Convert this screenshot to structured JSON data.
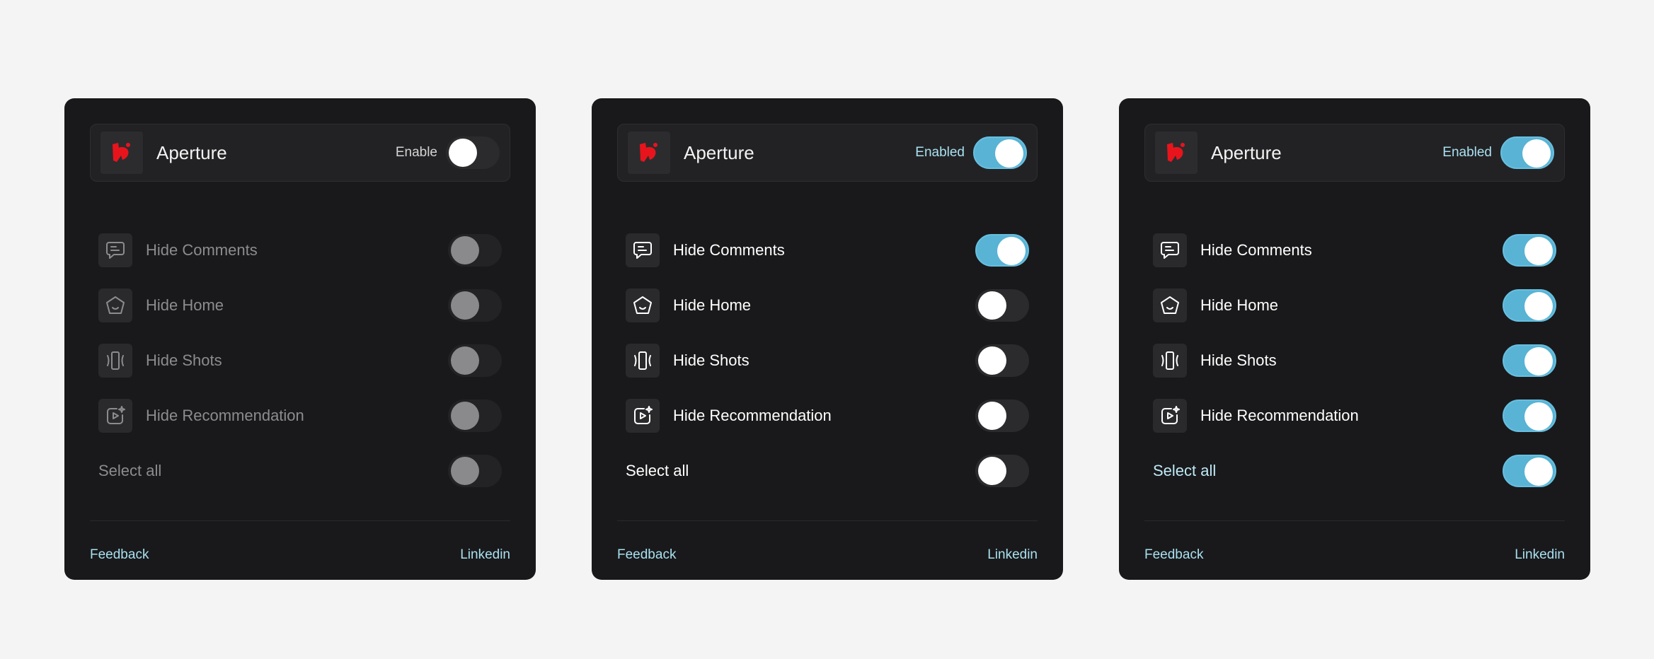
{
  "panels": [
    {
      "app_name": "Aperture",
      "status_label": "Enable",
      "items": [
        {
          "label": "Hide Comments"
        },
        {
          "label": "Hide Home"
        },
        {
          "label": "Hide Shots"
        },
        {
          "label": "Hide Recommendation"
        }
      ],
      "select_all_label": "Select all",
      "feedback_label": "Feedback",
      "linkedin_label": "Linkedin",
      "master_on": false,
      "item_states": [
        false,
        false,
        false,
        false
      ],
      "select_all_on": false
    },
    {
      "app_name": "Aperture",
      "status_label": "Enabled",
      "items": [
        {
          "label": "Hide Comments"
        },
        {
          "label": "Hide Home"
        },
        {
          "label": "Hide Shots"
        },
        {
          "label": "Hide Recommendation"
        }
      ],
      "select_all_label": "Select all",
      "feedback_label": "Feedback",
      "linkedin_label": "Linkedin",
      "master_on": true,
      "item_states": [
        true,
        false,
        false,
        false
      ],
      "select_all_on": false
    },
    {
      "app_name": "Aperture",
      "status_label": "Enabled",
      "items": [
        {
          "label": "Hide Comments"
        },
        {
          "label": "Hide Home"
        },
        {
          "label": "Hide Shots"
        },
        {
          "label": "Hide Recommendation"
        }
      ],
      "select_all_label": "Select all",
      "feedback_label": "Feedback",
      "linkedin_label": "Linkedin",
      "master_on": true,
      "item_states": [
        true,
        true,
        true,
        true
      ],
      "select_all_on": true
    }
  ],
  "icons": [
    "aperture-logo-icon",
    "comment-icon",
    "home-icon",
    "shots-icon",
    "recommendation-icon"
  ],
  "colors": {
    "background": "#f4f4f4",
    "panel": "#19191b",
    "toggle_on": "#58b3d4",
    "link": "#a9e0f0",
    "brand_red": "#e8141c"
  }
}
